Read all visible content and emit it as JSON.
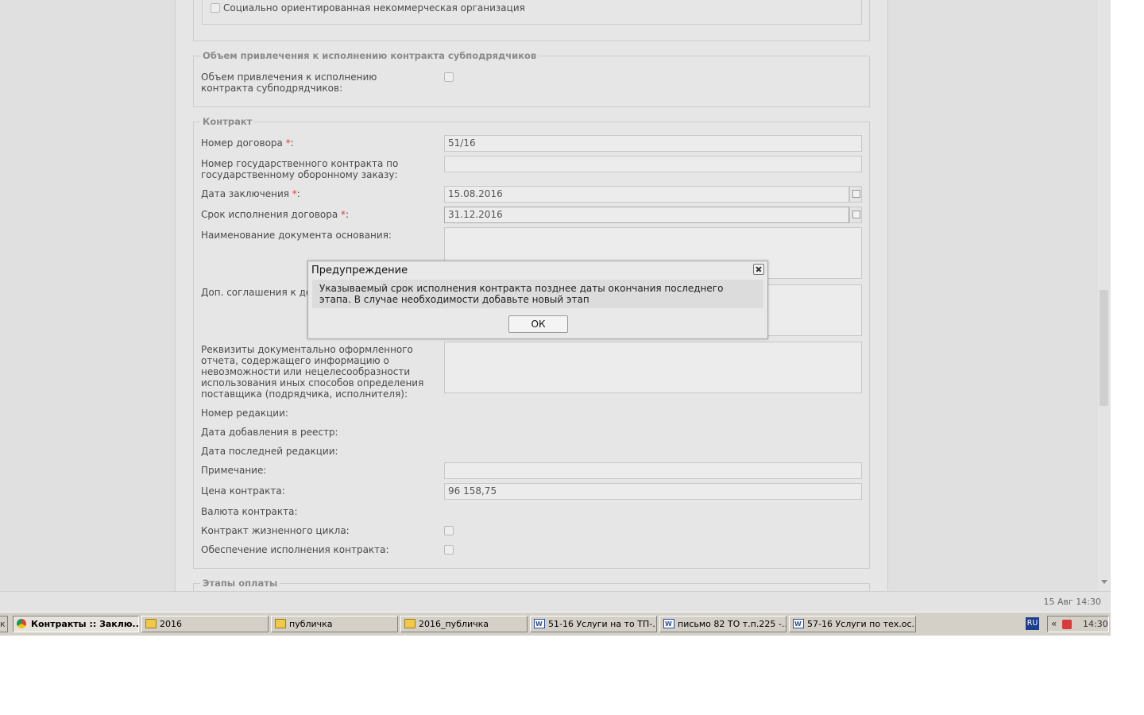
{
  "form": {
    "social_org_label": "Социально ориентированная некоммерческая организация",
    "subcontractors_section": {
      "legend": "Объем привлечения к исполнению контракта субподрядчиков",
      "field_label": "Объем привлечения к исполнению контракта субподрядчиков:"
    },
    "contract_section": {
      "legend": "Контракт",
      "contract_number": {
        "label": "Номер договора ",
        "value": "51/16"
      },
      "defense_contract_number": {
        "label": "Номер государственного контракта по государственному оборонному заказу:",
        "value": ""
      },
      "conclusion_date": {
        "label": "Дата заключения ",
        "value": "15.08.2016"
      },
      "execution_term": {
        "label": "Срок исполнения договора ",
        "value": "31.12.2016"
      },
      "basis_document": {
        "label": "Наименование документа основания:"
      },
      "supplementary": {
        "label": "Доп. соглашения к дого"
      },
      "report_requisites": {
        "label": "Реквизиты документально оформленного отчета, содержащего информацию о невозможности или нецелесообразности использования иных способов определения поставщика (подрядчика, исполнителя):"
      },
      "revision_number": {
        "label": "Номер редакции:"
      },
      "registry_date": {
        "label": "Дата добавления в реестр:"
      },
      "last_revision_date": {
        "label": "Дата последней редакции:"
      },
      "note": {
        "label": "Примечание:",
        "value": ""
      },
      "price": {
        "label": "Цена контракта:",
        "value": "96 158,75"
      },
      "currency": {
        "label": "Валюта контракта:"
      },
      "lifecycle": {
        "label": "Контракт жизненного цикла:"
      },
      "security": {
        "label": "Обеспечение исполнения контракта:"
      }
    },
    "payment_section": {
      "legend": "Этапы оплаты"
    },
    "required_mark": "*",
    "colon": ":"
  },
  "dialog": {
    "title": "Предупреждение",
    "message": "Указываемый срок исполнения контракта позднее даты окончания последнего этапа. В случае необходимости добавьте новый этап",
    "ok_label": "ОК"
  },
  "status_bar": {
    "datetime": "15 Авг 14:30"
  },
  "taskbar": {
    "left_fragment": "к",
    "items": [
      {
        "label": "Контракты :: Заклю...",
        "icon": "chrome-icon",
        "active": true
      },
      {
        "label": "2016",
        "icon": "folder-icon"
      },
      {
        "label": "публичка",
        "icon": "folder-icon"
      },
      {
        "label": "2016_публичка",
        "icon": "folder-icon"
      },
      {
        "label": "51-16 Услуги на то ТП-...",
        "icon": "word-icon"
      },
      {
        "label": "письмо 82  ТО т.п.225 -...",
        "icon": "word-icon"
      },
      {
        "label": "57-16 Услуги по тех.ос...",
        "icon": "word-icon"
      }
    ],
    "language": "RU",
    "tray_chevron": "«",
    "clock": "14:30"
  },
  "colors": {
    "required": "#e23b3b",
    "page_bg": "#e6e6e6",
    "taskbar_bg": "#d4d0c8",
    "lang_bg": "#1b3e8c"
  }
}
